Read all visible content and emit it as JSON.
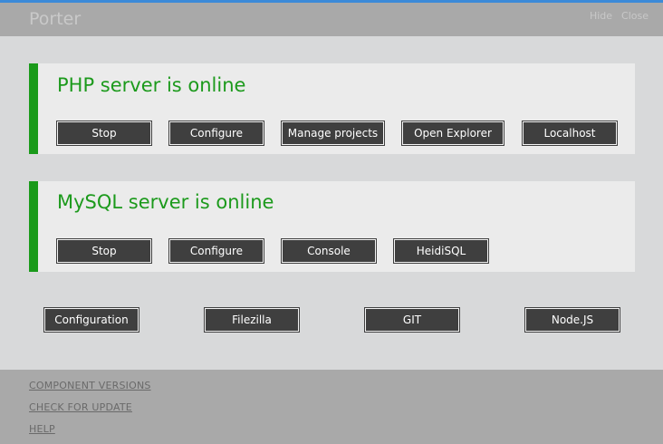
{
  "app": {
    "title": "Porter",
    "hide_label": "Hide",
    "close_label": "Close"
  },
  "php": {
    "status": "PHP server is online",
    "status_color": "#1c9a1c",
    "buttons": [
      "Stop",
      "Configure",
      "Manage projects",
      "Open Explorer",
      "Localhost"
    ]
  },
  "mysql": {
    "status": "MySQL server is online",
    "status_color": "#1c9a1c",
    "buttons": [
      "Stop",
      "Configure",
      "Console",
      "HeidiSQL"
    ]
  },
  "tools": {
    "buttons": [
      "Configuration",
      "Filezilla",
      "GIT",
      "Node.JS"
    ]
  },
  "footer": {
    "links": [
      "COMPONENT VERSIONS",
      "CHECK FOR UPDATE",
      "HELP"
    ]
  },
  "colors": {
    "accent": "#3c8ad8",
    "online": "#1a9a1a",
    "button": "#3f3f3f"
  }
}
